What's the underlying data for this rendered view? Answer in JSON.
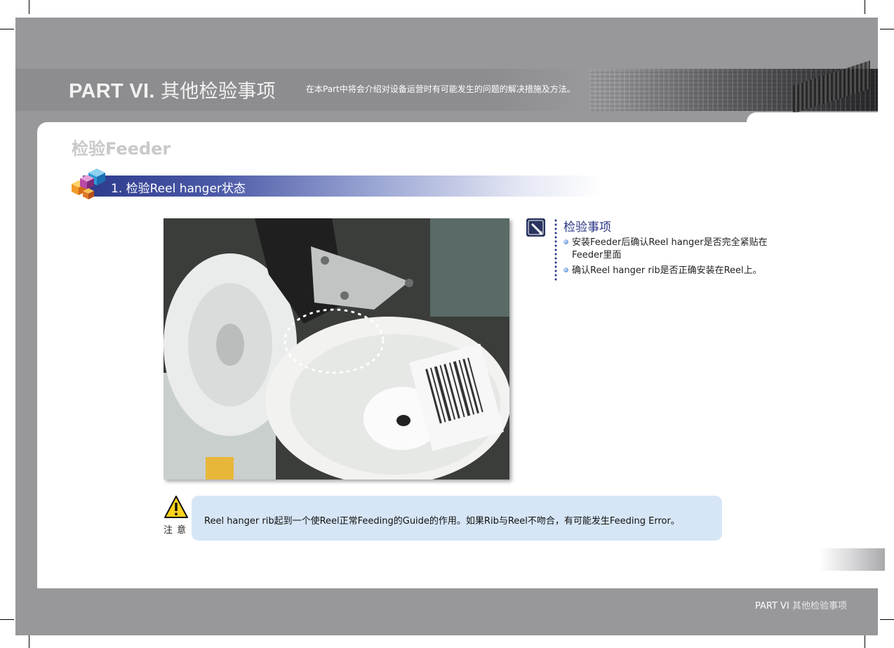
{
  "header": {
    "part_label": "PART VI.",
    "part_title": "其他检验事项",
    "subtitle": "在本Part中将会介绍对设备运营时有可能发生的问题的解决措施及方法。"
  },
  "page": {
    "section_title": "检验Feeder",
    "heading": "1.  检验Reel hanger状态"
  },
  "notes": {
    "title": "检验事项",
    "items": [
      "安装Feeder后确认Reel hanger是否完全紧贴在Feeder里面",
      "确认Reel hanger rib是否正确安装在Reel上。"
    ]
  },
  "caution": {
    "label": "注意",
    "text": "Reel hanger rib起到一个使Reel正常Feeding的Guide的作用。如果Rib与Reel不吻合，有可能发生Feeding Error。"
  },
  "footer": {
    "part": "PART VI",
    "title": "其他检验事项"
  },
  "colors": {
    "frame_grey": "#98989b",
    "heading_navy": "#2d3a8c",
    "caution_bg": "#d6e6f6"
  }
}
